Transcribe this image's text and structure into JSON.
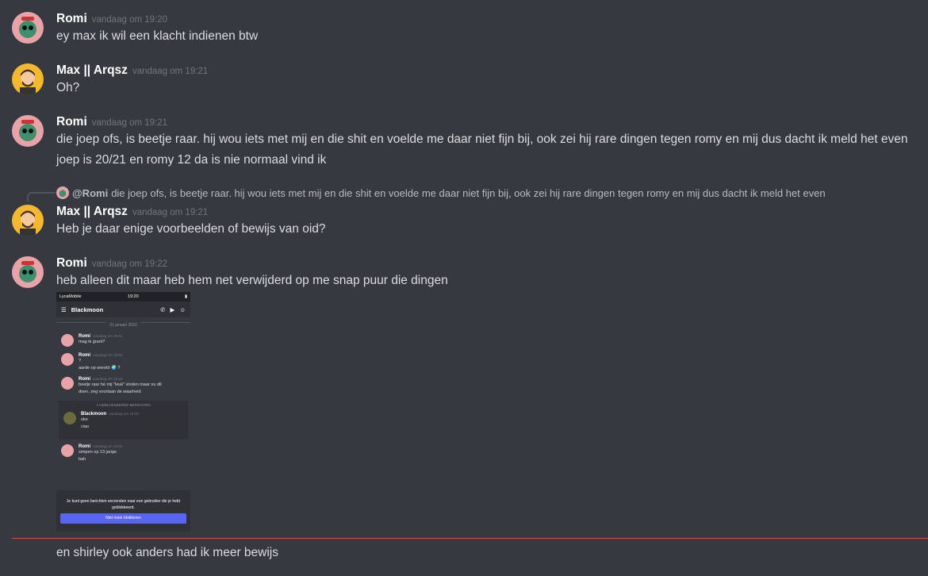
{
  "messages": [
    {
      "user": "Romi",
      "time": "vandaag om 19:20",
      "lines": [
        "ey max ik wil een klacht indienen btw"
      ]
    },
    {
      "user": "Max || Arqsz",
      "time": "vandaag om 19:21",
      "lines": [
        "Oh?"
      ]
    },
    {
      "user": "Romi",
      "time": "vandaag om 19:21",
      "lines": [
        "die joep ofs, is beetje raar. hij wou iets met mij en die shit en voelde me daar niet fijn bij, ook zei hij rare dingen tegen romy en mij dus dacht ik meld het even",
        "joep is 20/21 en romy 12 da is nie normaal vind ik"
      ]
    },
    {
      "user": "Max || Arqsz",
      "time": "vandaag om 19:21",
      "lines": [
        "Heb je daar enige voorbeelden of bewijs van oid?"
      ],
      "reply": {
        "mention": "@Romi",
        "text": "die joep ofs, is beetje raar. hij wou iets met mij en die shit en voelde me daar niet fijn bij, ook zei hij rare dingen tegen romy en mij dus dacht ik meld het even"
      }
    },
    {
      "user": "Romi",
      "time": "vandaag om 19:22",
      "lines": [
        "heb alleen dit maar heb hem net verwijderd op me snap puur die dingen"
      ]
    }
  ],
  "last_line": "en shirley ook anders had ik meer bewijs",
  "attachment": {
    "status_left": "LycaMobile",
    "status_time": "19:20",
    "channel": "Blackmoon",
    "date": "31 januari 2022",
    "msgs": [
      {
        "user": "Romi",
        "time": "vandaag om 18:31",
        "lines": [
          "mag ik grant?"
        ]
      },
      {
        "user": "Romi",
        "time": "vandaag om 18:59",
        "lines": [
          "?",
          "aarde op wereld 🌍 ?"
        ]
      },
      {
        "user": "Romi",
        "time": "vandaag om 19:19",
        "lines": [
          "beetje raar hè mij \"leuk\" vinden maar nu dit",
          "doen, zeg voortaan de waarheid"
        ]
      }
    ],
    "blocked_header": "2 GEBLOKKEERDE BERICHTEN",
    "blocked": {
      "user": "Blackmoon",
      "time": "vandaag om 19:20",
      "lines": [
        "oke",
        "ciao"
      ]
    },
    "after": {
      "user": "Romi",
      "time": "vandaag om 19:20",
      "lines": [
        "simpen op 13 jarige",
        "bah"
      ]
    },
    "footer_text": "Je kunt geen berichten verzenden naar een gebruiker die je hebt geblokkeerd.",
    "footer_button": "Niet meer blokkeren"
  },
  "colors": {
    "background": "#36393f",
    "divider": "#ed4245",
    "button": "#5865f2"
  }
}
